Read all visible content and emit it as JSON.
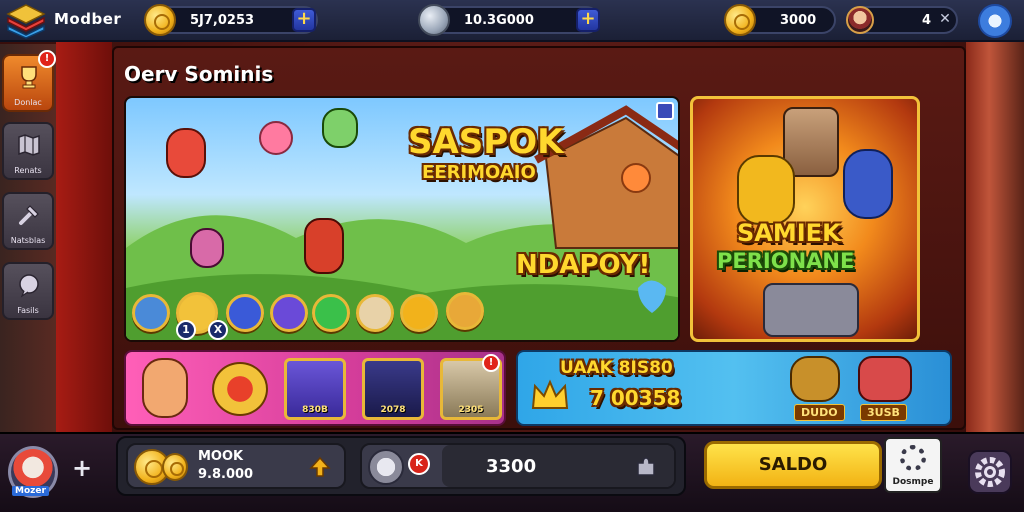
{
  "app": {
    "brand": "Modber"
  },
  "topbar": {
    "coins": {
      "value": "5J7,0253",
      "icon": "gold-coin-icon"
    },
    "shields": {
      "value": "10.3G000",
      "icon": "shield-coin-icon"
    },
    "gems": {
      "value": "3000",
      "icon": "gold-coin-icon"
    },
    "level": {
      "value": "4"
    },
    "plus_label": "+"
  },
  "sidebar": {
    "items": [
      {
        "label": "Donlac",
        "icon": "trophy-icon",
        "badge": "!"
      },
      {
        "label": "Renats",
        "icon": "map-icon"
      },
      {
        "label": "Natsblas",
        "icon": "tools-icon"
      },
      {
        "label": "Fasils",
        "icon": "chat-icon"
      }
    ]
  },
  "main": {
    "title": "Oerv Sominis",
    "banner_main": {
      "headline": "SASPOK",
      "subhead": "EERIMOAIO",
      "callout": "NDAPOY!",
      "icon_labels": [
        "1",
        "X"
      ]
    },
    "banner_side": {
      "line1": "SAMIEK",
      "line2": "PERIONANE"
    },
    "strip_left": {
      "cards": [
        {
          "label": "830B"
        },
        {
          "label": "2078"
        },
        {
          "label": "2305",
          "badge": "!"
        }
      ]
    },
    "strip_right": {
      "title": "UAAK 8IS80",
      "value": "7 00358",
      "tags": [
        "DUDO",
        "3USB"
      ]
    }
  },
  "bottombar": {
    "plus_label": "+",
    "user_tag": "Mozer",
    "wallet": {
      "name": "MOOK",
      "value": "9.8.000"
    },
    "center": {
      "value": "3300",
      "badge": "K"
    },
    "saldo_label": "SALDO",
    "square_label": "Dosmpe"
  },
  "colors": {
    "accent_gold": "#f2b21b",
    "panel_red": "#5a1a14",
    "pink_strip": "#ff5fb8",
    "blue_strip": "#2fa6e8",
    "saldo_yellow": "#ffe34a"
  }
}
